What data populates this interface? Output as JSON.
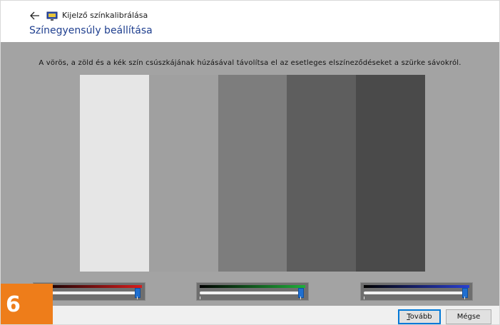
{
  "header": {
    "back_icon": "arrow-left-icon",
    "app_icon": "monitor-icon",
    "app_title": "Kijelző színkalibrálása",
    "page_title": "Színegyensúly beállítása"
  },
  "main": {
    "instruction": "A vörös, a zöld és a kék szín csúszkájának húzásával távolítsa el az esetleges elszíneződéseket a szürke sávokról.",
    "bars": [
      {
        "color": "#e6e6e6"
      },
      {
        "color": "#a0a0a0"
      },
      {
        "color": "#7d7d7d"
      },
      {
        "color": "#5e5e5e"
      },
      {
        "color": "#4a4a4a"
      }
    ]
  },
  "sliders": [
    {
      "channel": "red",
      "gradient_color": "#d81c1c",
      "level": 1.0
    },
    {
      "channel": "green",
      "gradient_color": "#1fae3a",
      "level": 1.0
    },
    {
      "channel": "blue",
      "gradient_color": "#2a3fd0",
      "level": 1.0
    }
  ],
  "footer": {
    "next_label_mnemonic": "T",
    "next_label_rest": "ovább",
    "cancel_label": "Mégse"
  },
  "badge": {
    "step_number": "6",
    "color": "#ee7d1a"
  }
}
